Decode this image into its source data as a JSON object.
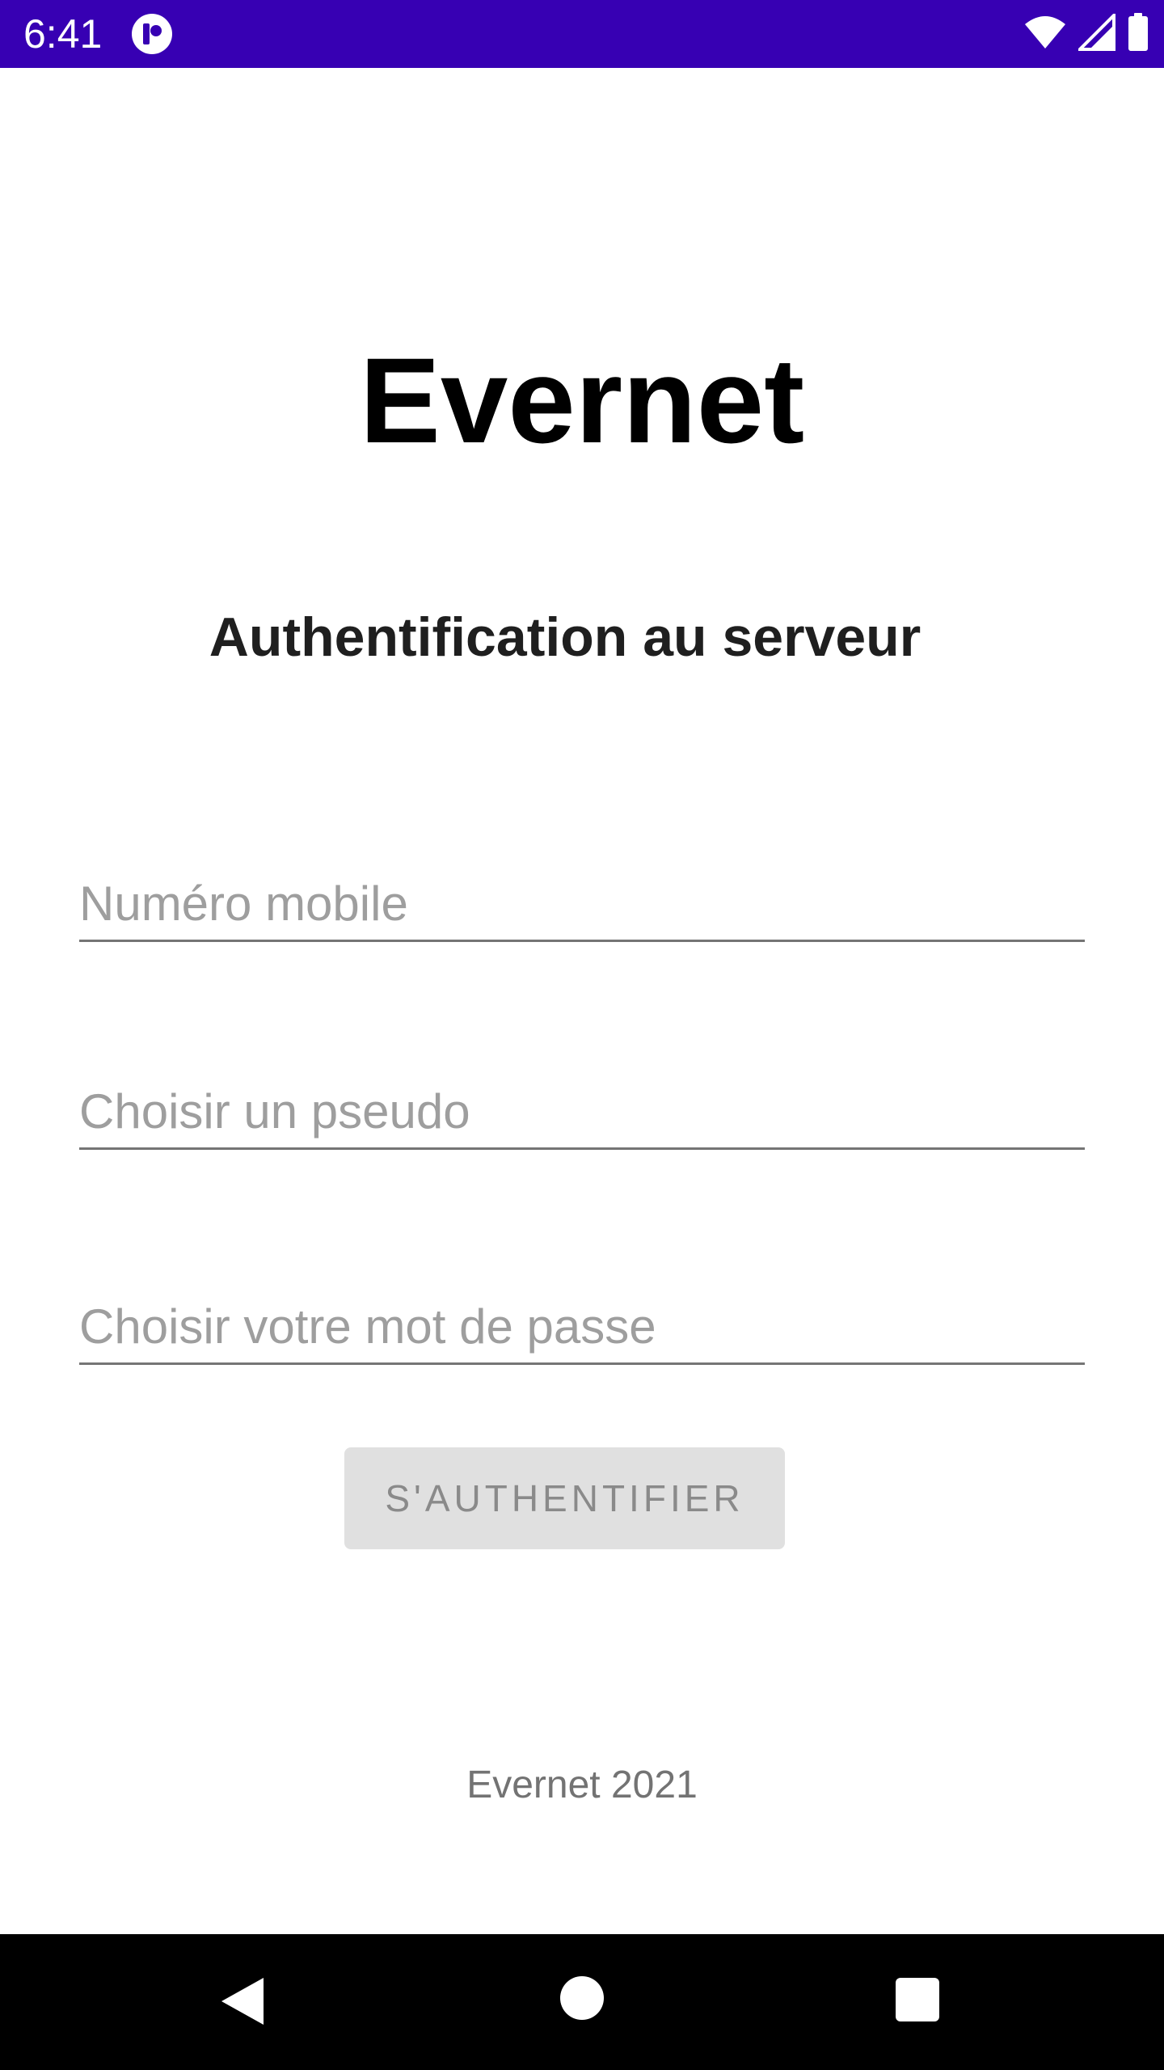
{
  "status_bar": {
    "time": "6:41",
    "icons": [
      "app-notification-icon",
      "wifi-icon",
      "signal-icon",
      "battery-icon"
    ],
    "background": "#3700b3"
  },
  "app": {
    "title": "Evernet",
    "subtitle": "Authentification au serveur"
  },
  "form": {
    "phone_placeholder": "Numéro mobile",
    "phone_value": "",
    "pseudo_placeholder": "Choisir un pseudo",
    "pseudo_value": "",
    "password_placeholder": "Choisir votre mot de passe",
    "password_value": "",
    "submit_label": "S'AUTHENTIFIER"
  },
  "footer": {
    "text": "Evernet 2021"
  },
  "nav_bar": {
    "icons": [
      "back-icon",
      "home-icon",
      "recents-icon"
    ]
  }
}
